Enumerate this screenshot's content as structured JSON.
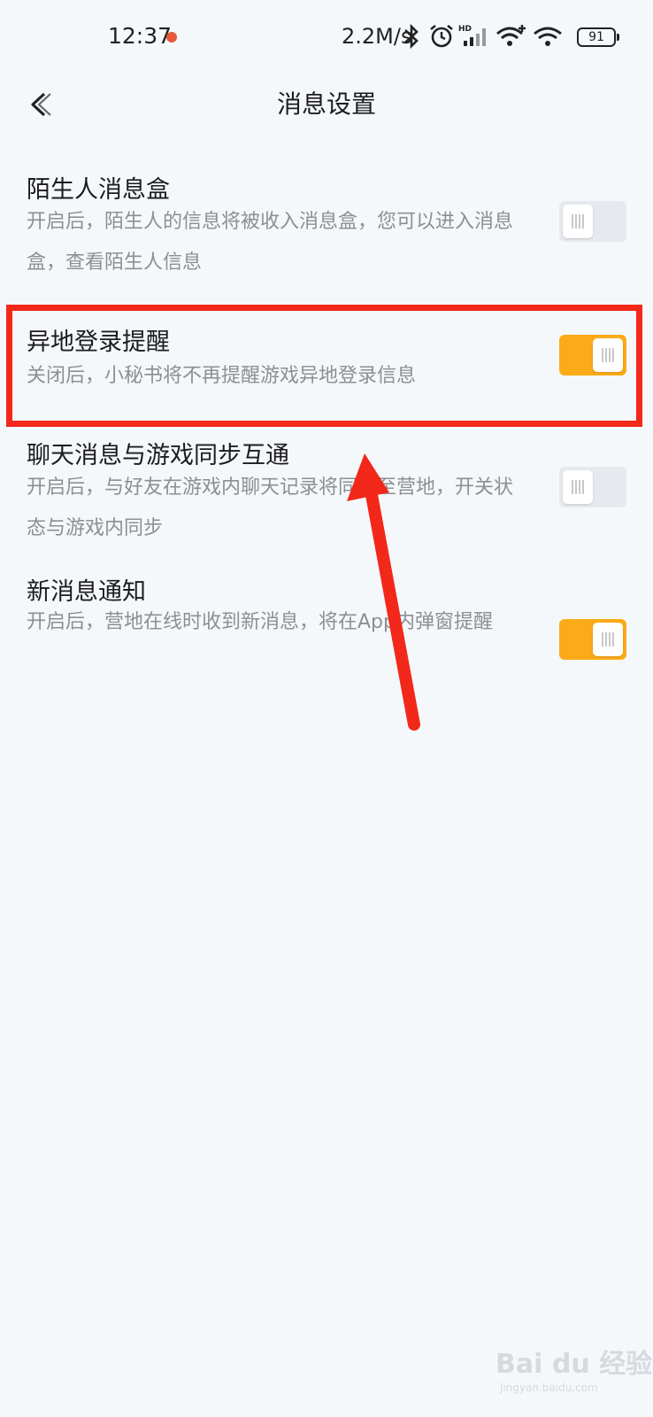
{
  "status_bar": {
    "time": "12:37",
    "net_speed": "2.2M/s",
    "battery": "91",
    "icons": [
      "notification-dot-icon",
      "bluetooth-icon",
      "alarm-icon",
      "hd-signal-icon",
      "wifi-plus-icon",
      "wifi-icon",
      "battery-icon"
    ]
  },
  "header": {
    "back_icon": "chevron-left-icon",
    "title": "消息设置"
  },
  "settings": [
    {
      "title": "陌生人消息盒",
      "desc": "开启后，陌生人的信息将被收入消息盒，您可以进入消息盒，查看陌生人信息",
      "enabled": false
    },
    {
      "title": "异地登录提醒",
      "desc": "关闭后，小秘书将不再提醒游戏异地登录信息",
      "enabled": true
    },
    {
      "title": "聊天消息与游戏同步互通",
      "desc": "开启后，与好友在游戏内聊天记录将同步至营地，开关状态与游戏内同步",
      "enabled": false
    },
    {
      "title": "新消息通知",
      "desc": "开启后，营地在线时收到新消息，将在App内弹窗提醒",
      "enabled": true
    }
  ],
  "colors": {
    "accent": "#fbab18",
    "toggle_off": "#e6e9ee",
    "annotation": "#f2281a",
    "background": "#f5f8fb"
  },
  "watermark": {
    "text": "Bai du 经验",
    "sub": "jingyan.baidu.com"
  }
}
